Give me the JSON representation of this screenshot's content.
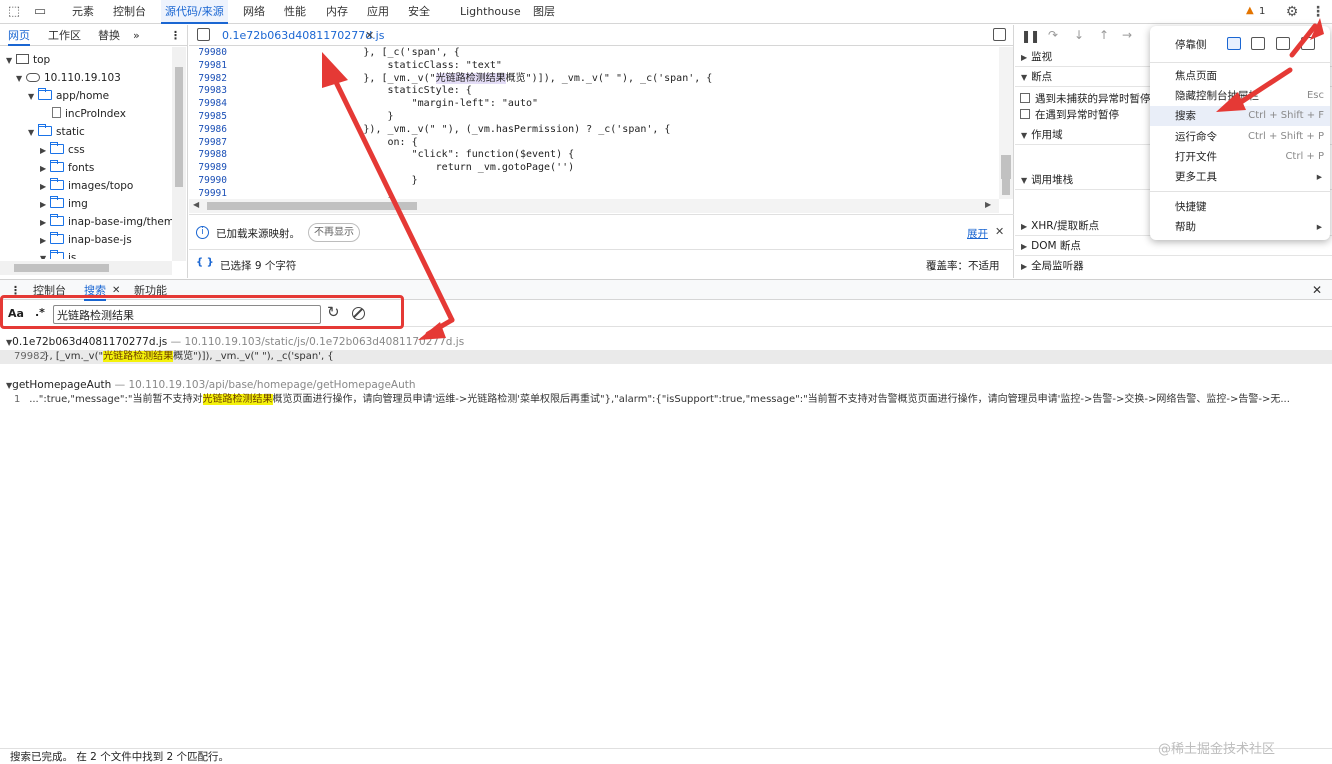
{
  "toolbar": {
    "tabs": [
      "元素",
      "控制台",
      "源代码/来源",
      "网络",
      "性能",
      "内存",
      "应用",
      "安全",
      "Lighthouse",
      "图层"
    ],
    "active_tab": "源代码/来源",
    "issue_count": "1"
  },
  "navigator": {
    "tabs": [
      "网页",
      "工作区",
      "替换"
    ],
    "more": "»",
    "items": [
      "top",
      "10.110.19.103",
      "app/home",
      "incProIndex",
      "static",
      "css",
      "fonts",
      "images/topo",
      "img",
      "inap-base-img/theme",
      "inap-base-js",
      "js"
    ]
  },
  "editor": {
    "file_tab": "0.1e72b063d4081170277d.js",
    "line_numbers": [
      "79980",
      "79981",
      "79982",
      "79983",
      "79984",
      "79985",
      "79986",
      "79987",
      "79988",
      "79989",
      "79990",
      "79991"
    ],
    "code": [
      "                    }, [_c('span', {",
      "                        staticClass: \"text\"",
      "                    }, [_vm._v(\"光链路检测结果概览\")]), _vm._v(\" \"), _c('span', {",
      "                        staticStyle: {",
      "                            \"margin-left\": \"auto\"",
      "                        }",
      "                    }), _vm._v(\" \"), (_vm.hasPermission) ? _c('span', {",
      "                        on: {",
      "                            \"click\": function($event) {",
      "                                return _vm.gotoPage('')",
      "                            }",
      "                        }"
    ],
    "info_text": "已加载来源映射。",
    "dont_show": "不再显示",
    "expand": "展开",
    "selection": "已选择 9 个字符",
    "coverage": "覆盖率：不适用"
  },
  "debugger": {
    "sections": [
      "监视",
      "断点",
      "遇到未捕获的异常时暂停",
      "在遇到异常时暂停",
      "作用域",
      "调用堆栈",
      "XHR/提取断点",
      "DOM 断点",
      "全局监听器"
    ]
  },
  "drawer": {
    "tabs": [
      "控制台",
      "搜索",
      "新功能"
    ],
    "active_tab": "搜索"
  },
  "search": {
    "case_label": "Aa",
    "regex_label": ".*",
    "query": "光链路检测结果",
    "results": [
      {
        "file": "0.1e72b063d4081170277d.js",
        "path": "10.110.19.103/static/js/0.1e72b063d4081170277d.js",
        "line_no": "79982",
        "before": "}, [_vm._v(\"",
        "match": "光链路检测结果",
        "after": "概览\")]), _vm._v(\" \"), _c('span', {"
      },
      {
        "file": "getHomepageAuth",
        "path": "10.110.19.103/api/base/homepage/getHomepageAuth",
        "line_no": "1",
        "before": "...\":true,\"message\":\"当前暂不支持对",
        "match": "光链路检测结果",
        "after": "概览页面进行操作，请向管理员申请'运维->光链路检测'菜单权限后再重试\"},\"alarm\":{\"isSupport\":true,\"message\":\"当前暂不支持对告警概览页面进行操作，请向管理员申请'监控->告警->交换->网络告警、监控->告警->无..."
      }
    ],
    "status": "搜索已完成。  在 2 个文件中找到 2 个匹配行。"
  },
  "menu": {
    "dock_label": "停靠侧",
    "items": [
      {
        "label": "焦点页面",
        "shortcut": ""
      },
      {
        "label": "隐藏控制台抽屉栏",
        "shortcut": "Esc"
      },
      {
        "label": "搜索",
        "shortcut": "Ctrl + Shift + F"
      },
      {
        "label": "运行命令",
        "shortcut": "Ctrl + Shift + P"
      },
      {
        "label": "打开文件",
        "shortcut": "Ctrl + P"
      },
      {
        "label": "更多工具",
        "shortcut": ""
      },
      {
        "label": "快捷键",
        "shortcut": ""
      },
      {
        "label": "帮助",
        "shortcut": ""
      }
    ]
  },
  "watermark": "@稀土掘金技术社区",
  "colors": {
    "accent": "#1a66d2",
    "annotation": "#e53935",
    "highlight": "#f4f20b"
  }
}
